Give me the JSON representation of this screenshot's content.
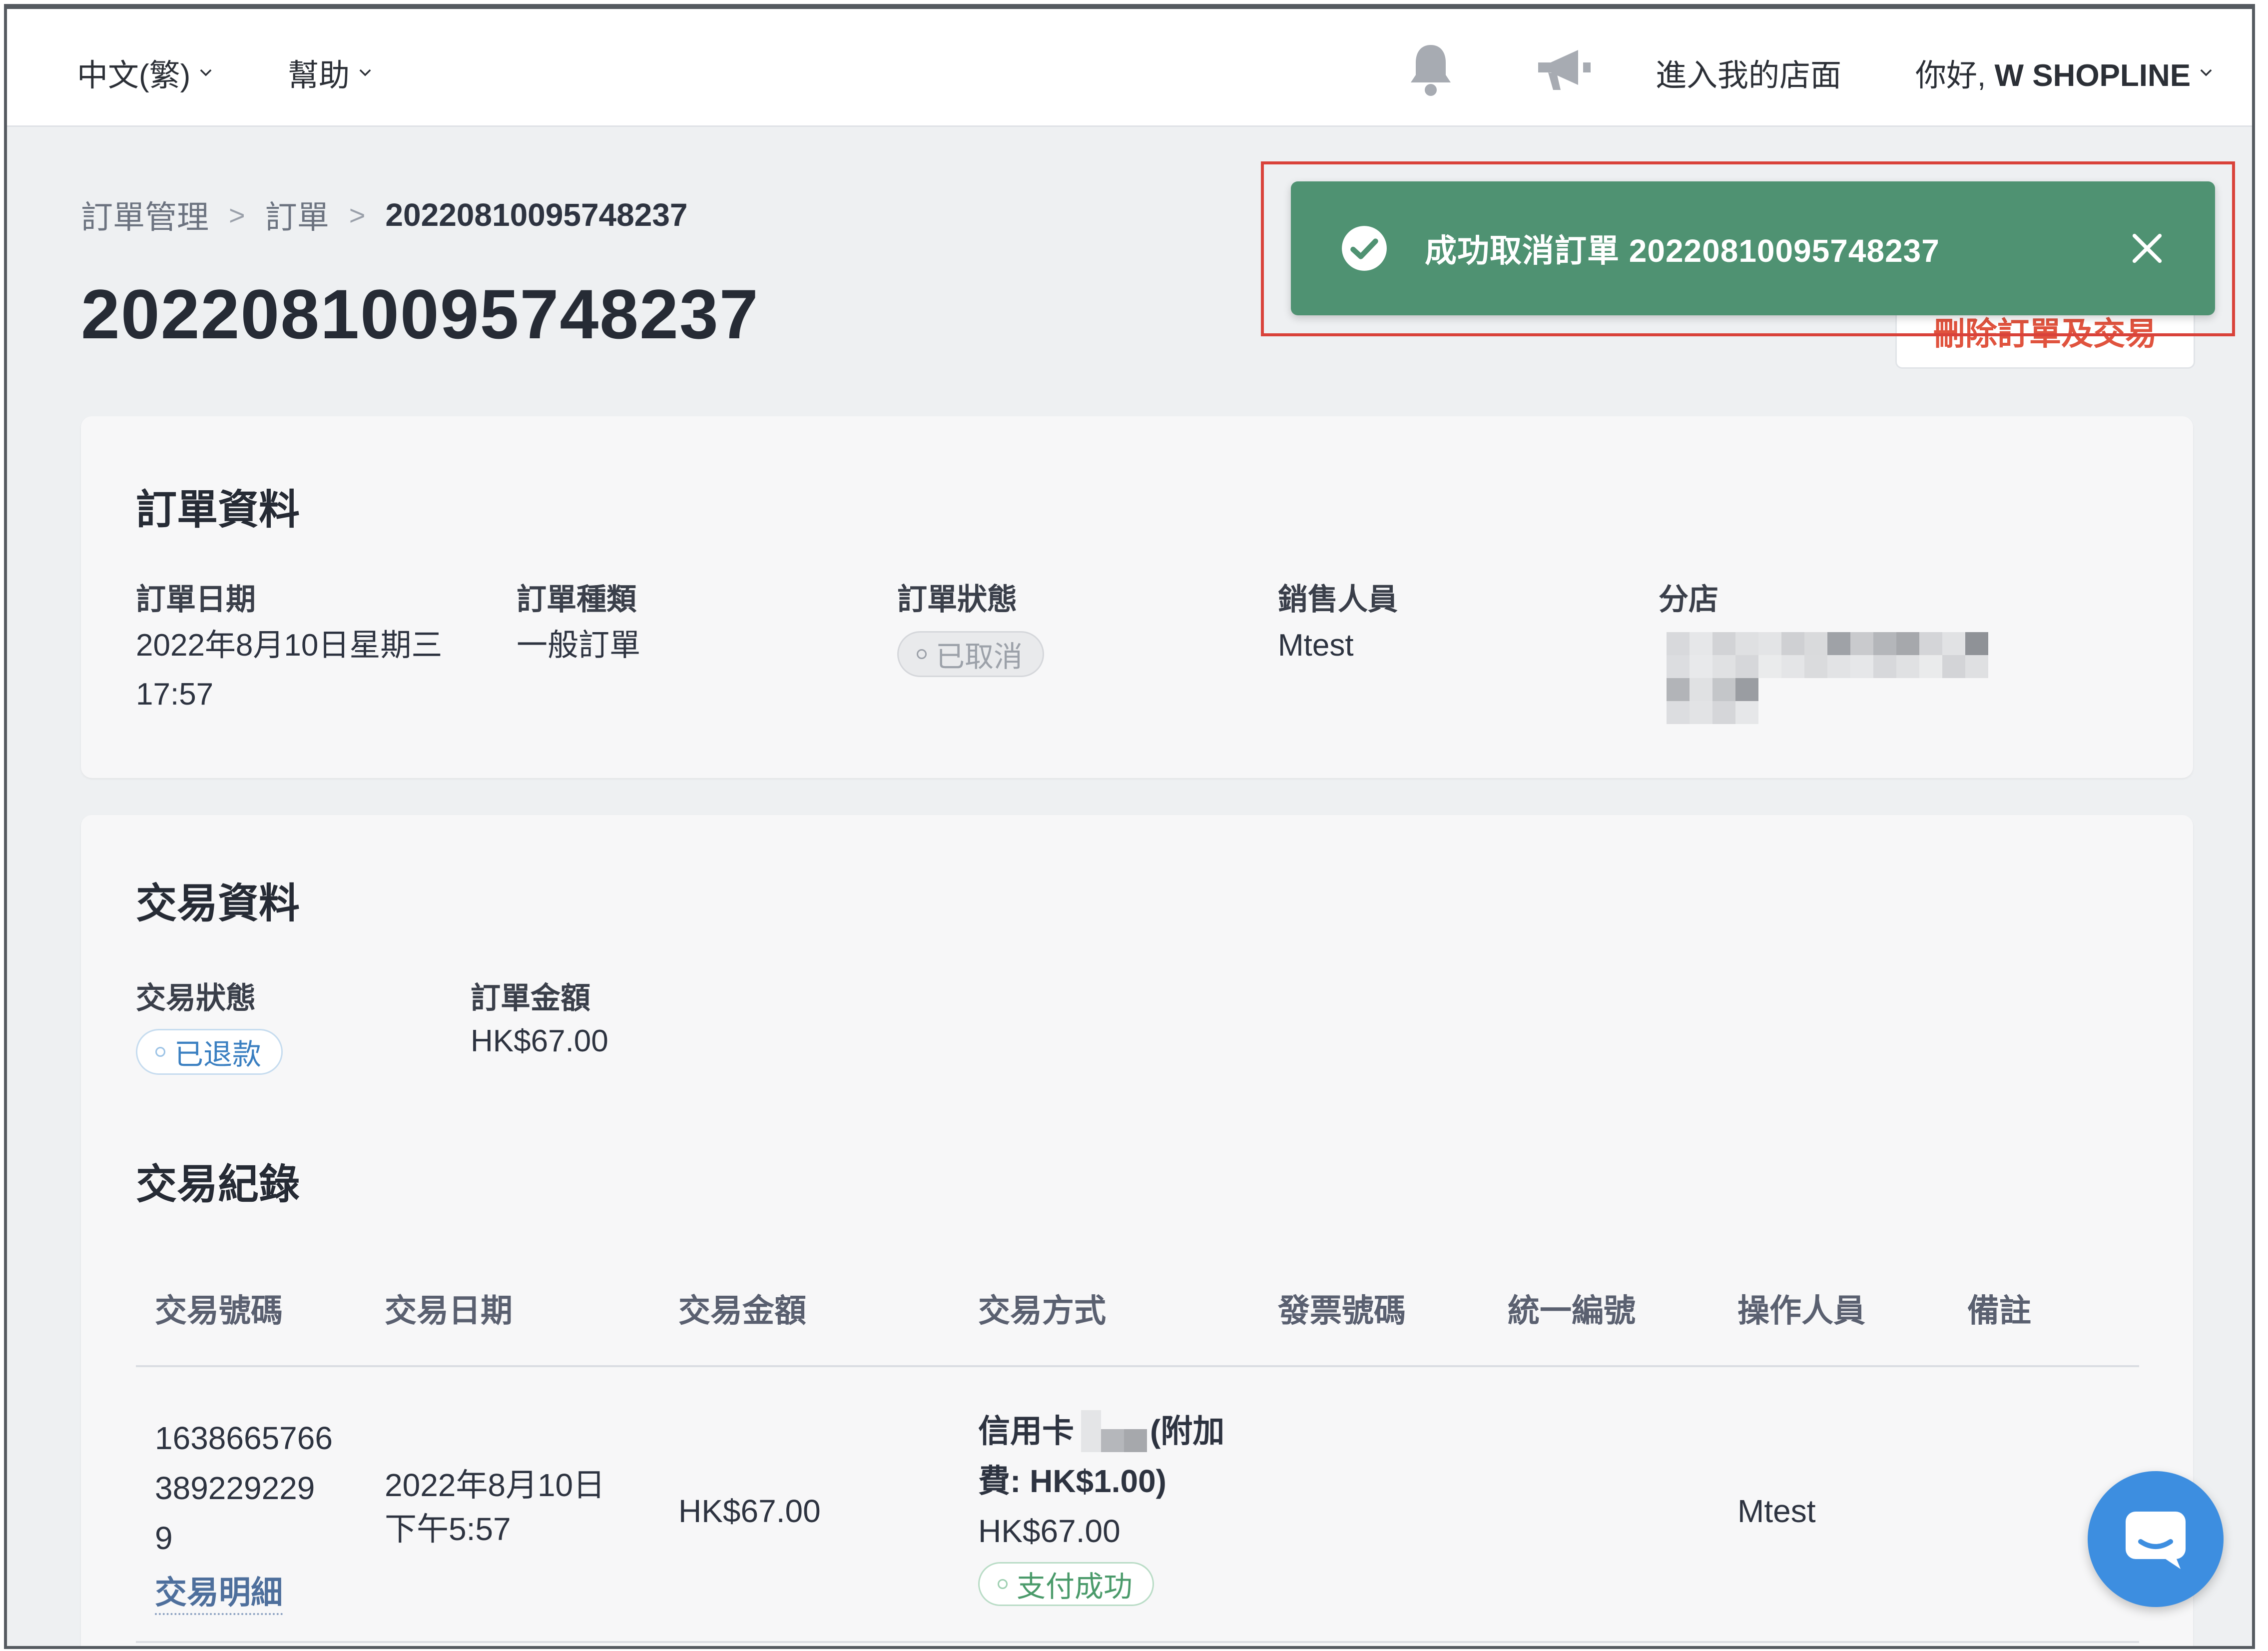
{
  "topnav": {
    "language": "中文(繁)",
    "help": "幫助",
    "notifications_icon": "bell-icon",
    "announcements_icon": "megaphone-icon",
    "enter_store": "進入我的店面",
    "greeting_prefix": "你好, ",
    "user_name": "W SHOPLINE"
  },
  "breadcrumb": {
    "items": [
      "訂單管理",
      "訂單"
    ],
    "current": "20220810095748237"
  },
  "page_title": "20220810095748237",
  "toast": {
    "message": "成功取消訂單 20220810095748237",
    "color": "#4f9272",
    "highlight_color": "#d9423a"
  },
  "actions": {
    "delete_label": "刪除訂單及交易"
  },
  "order_info": {
    "title": "訂單資料",
    "date_label": "訂單日期",
    "date_line1": "2022年8月10日星期三",
    "date_line2": "17:57",
    "type_label": "訂單種類",
    "type_value": "一般訂單",
    "status_label": "訂單狀態",
    "status_value": "已取消",
    "sales_label": "銷售人員",
    "sales_value": "Mtest",
    "branch_label": "分店"
  },
  "transaction_info": {
    "title": "交易資料",
    "status_label": "交易狀態",
    "status_value": "已退款",
    "amount_label": "訂單金額",
    "amount_value": "HK$67.00"
  },
  "transaction_records": {
    "title": "交易紀錄",
    "columns": [
      "交易號碼",
      "交易日期",
      "交易金額",
      "交易方式",
      "發票號碼",
      "統一編號",
      "操作人員",
      "備註"
    ],
    "rows": [
      {
        "txn_no_line1": "1638665766",
        "txn_no_line2": "389229229",
        "txn_no_line3": "9",
        "details_link": "交易明細",
        "date_line1": "2022年8月10日",
        "date_line2": "下午5:57",
        "amount": "HK$67.00",
        "method_line1_a": "信用卡",
        "method_line1_b": "(附加",
        "method_line2": "費: HK$1.00)",
        "method_line3": "HK$67.00",
        "payment_status": "支付成功",
        "invoice_no": "",
        "tax_id": "",
        "operator": "Mtest",
        "remarks": ""
      }
    ]
  },
  "chat_icon": "chat-bubble-icon"
}
